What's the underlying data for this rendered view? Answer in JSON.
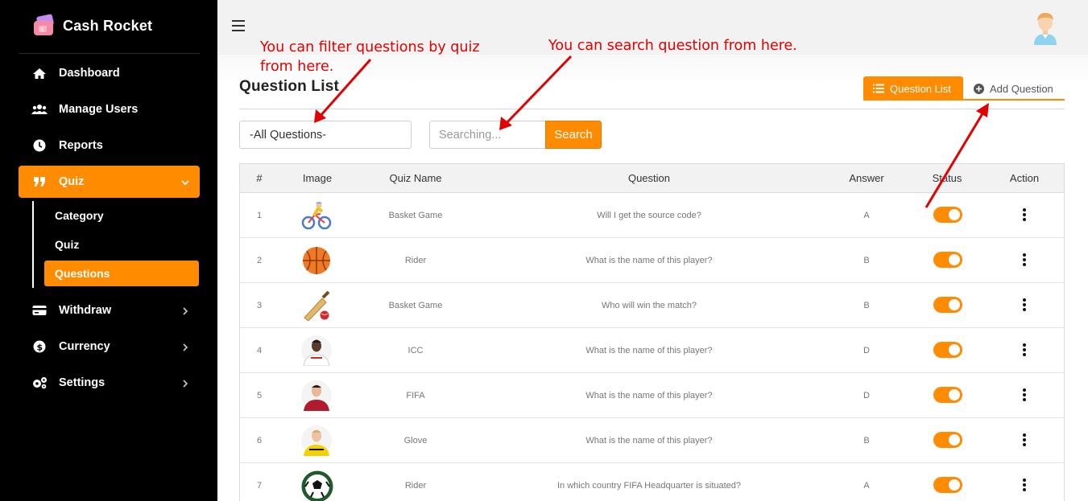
{
  "brand": {
    "name": "Cash Rocket"
  },
  "sidebar": {
    "items": [
      {
        "label": "Dashboard",
        "icon": "home-icon"
      },
      {
        "label": "Manage Users",
        "icon": "users-icon"
      },
      {
        "label": "Reports",
        "icon": "clock-icon"
      },
      {
        "label": "Quiz",
        "icon": "quote-icon"
      },
      {
        "label": "Withdraw",
        "icon": "card-icon"
      },
      {
        "label": "Currency",
        "icon": "dollar-icon"
      },
      {
        "label": "Settings",
        "icon": "gears-icon"
      }
    ],
    "quiz_sub": [
      {
        "label": "Category"
      },
      {
        "label": "Quiz"
      },
      {
        "label": "Questions"
      }
    ]
  },
  "page": {
    "title": "Question List",
    "tab_list": "Question List",
    "tab_add": "Add Question"
  },
  "filter": {
    "value": "-All Questions-"
  },
  "search": {
    "placeholder": "Searching...",
    "button": "Search"
  },
  "table": {
    "headers": [
      "#",
      "Image",
      "Quiz Name",
      "Question",
      "Answer",
      "Status",
      "Action"
    ],
    "rows": [
      {
        "num": "1",
        "image": "cyclist",
        "quiz": "Basket Game",
        "question": "Will I get the source code?",
        "answer": "A",
        "status": true
      },
      {
        "num": "2",
        "image": "basketball",
        "quiz": "Rider",
        "question": "What is the name of this player?",
        "answer": "B",
        "status": true
      },
      {
        "num": "3",
        "image": "cricket",
        "quiz": "Basket Game",
        "question": "Who will win the match?",
        "answer": "B",
        "status": true
      },
      {
        "num": "4",
        "image": "player-white-kit",
        "quiz": "ICC",
        "question": "What is the name of this player?",
        "answer": "D",
        "status": true
      },
      {
        "num": "5",
        "image": "player-red-kit",
        "quiz": "FIFA",
        "question": "What is the name of this player?",
        "answer": "D",
        "status": true
      },
      {
        "num": "6",
        "image": "player-yellow-kit",
        "quiz": "Glove",
        "question": "What is the name of this player?",
        "answer": "B",
        "status": true
      },
      {
        "num": "7",
        "image": "soccer-ball",
        "quiz": "Rider",
        "question": "In which country FIFA Headquarter is situated?",
        "answer": "A",
        "status": true
      }
    ]
  },
  "annotations": {
    "filter_note_line1": "You can filter questions by quiz",
    "filter_note_line2": "from here.",
    "search_note": "You can search question from here."
  },
  "colors": {
    "accent": "#ff8c00",
    "sidebar": "#000000",
    "annotation": "#e30000"
  }
}
